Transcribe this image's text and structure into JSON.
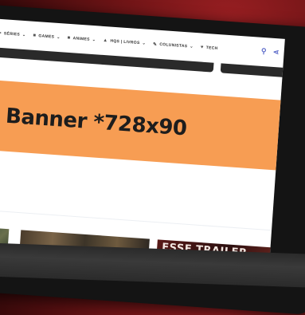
{
  "nav": {
    "items": [
      {
        "icon": "tv-icon",
        "glyph": "▪",
        "label": "SÉRIES",
        "has_dropdown": true
      },
      {
        "icon": "gamepad-icon",
        "glyph": "■",
        "label": "GAMES",
        "has_dropdown": true
      },
      {
        "icon": "anime-icon",
        "glyph": "■",
        "label": "ANIMES",
        "has_dropdown": true
      },
      {
        "icon": "book-icon",
        "glyph": "▲",
        "label": "HQS | LIVROS",
        "has_dropdown": true
      },
      {
        "icon": "pencil-icon",
        "glyph": "✎",
        "label": "COLUNISTAS",
        "has_dropdown": true
      },
      {
        "icon": "heart-icon",
        "glyph": "♥",
        "label": "TECH",
        "has_dropdown": false
      }
    ],
    "dropdown_glyph": "⌄",
    "search_glyph": "⚲",
    "share_glyph": "⋖"
  },
  "banner": {
    "text": "Banner *728x90",
    "color": "#f79d53"
  },
  "thumbnails": [
    {
      "title": ""
    },
    {
      "title": ""
    },
    {
      "title": "ESSE TRAILER"
    }
  ],
  "colors": {
    "background": "#6e1416",
    "accent_icons": "#5b6ac9"
  }
}
